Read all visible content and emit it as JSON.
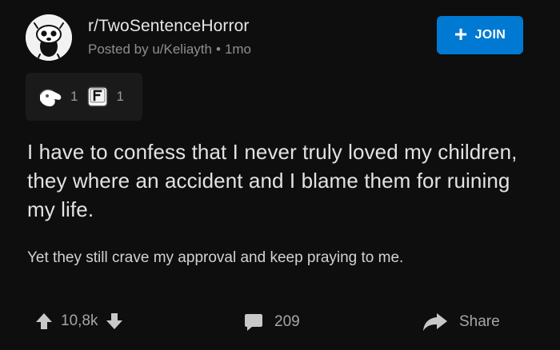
{
  "post": {
    "community": "r/TwoSentenceHorror",
    "posted_by": "Posted by u/Keliayth",
    "separator": "•",
    "age": "1mo",
    "join_label": "JOIN",
    "awards": [
      {
        "icon": "wholesome-hand-award-icon",
        "count": "1"
      },
      {
        "icon": "press-f-award-icon",
        "count": "1"
      }
    ],
    "title": "I have to confess that I never truly loved my children, they where an accident and I blame them for ruining my life.",
    "selftext": "Yet they still crave my approval and keep praying to me.",
    "score": "10,8k",
    "comments": "209",
    "share_label": "Share"
  },
  "colors": {
    "background": "#0e0e0e",
    "join_button": "#0079d3",
    "award_box": "#1a1a1b",
    "meta_text": "#8b8e90"
  }
}
